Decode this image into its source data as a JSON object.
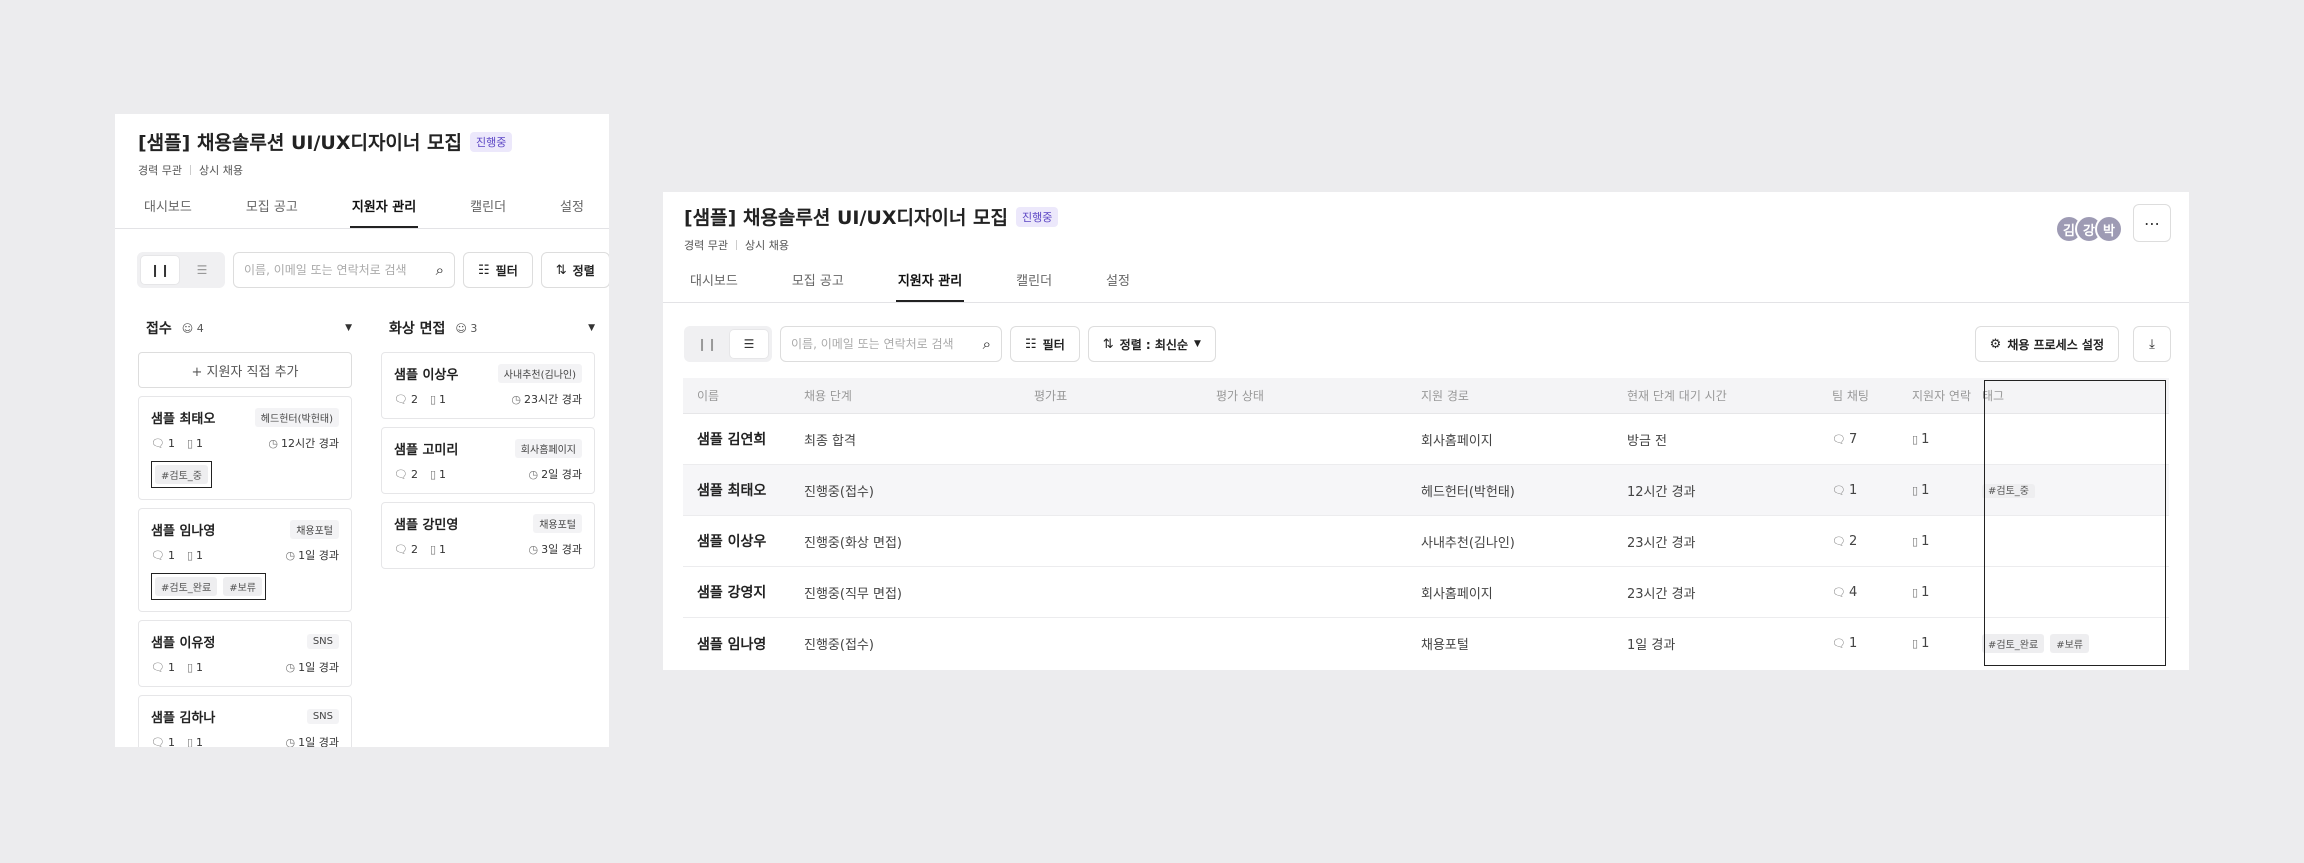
{
  "job": {
    "title": "[샘플] 채용솔루션 UI/UX디자이너 모집",
    "status_badge": "진행중",
    "experience": "경력 무관",
    "hire_type": "상시 채용"
  },
  "tabs": [
    "대시보드",
    "모집 공고",
    "지원자 관리",
    "캘린더",
    "설정"
  ],
  "toolbar": {
    "search_placeholder": "이름, 이메일 또는 연락처로 검색",
    "filter_label": "필터",
    "sort_label_short": "정렬",
    "sort_label": "정렬 : 최신순",
    "process_settings_label": "채용 프로세스 설정"
  },
  "kanban": {
    "add_applicant_label": "+ 지원자 직접 추가",
    "columns": [
      {
        "name": "접수",
        "count": "4",
        "cards": [
          {
            "name": "샘플 최태오",
            "source": "헤드헌터(박헌태)",
            "comments": "1",
            "memos": "1",
            "elapsed": "12시간 경과",
            "tags": [
              "#검토_중"
            ]
          },
          {
            "name": "샘플 임나영",
            "source": "채용포털",
            "comments": "1",
            "memos": "1",
            "elapsed": "1일 경과",
            "tags": [
              "#검토_완료",
              "#보류"
            ]
          },
          {
            "name": "샘플 이유정",
            "source": "SNS",
            "comments": "1",
            "memos": "1",
            "elapsed": "1일 경과",
            "tags": []
          },
          {
            "name": "샘플 김하나",
            "source": "SNS",
            "comments": "1",
            "memos": "1",
            "elapsed": "1일 경과",
            "tags": []
          }
        ]
      },
      {
        "name": "화상 면접",
        "count": "3",
        "cards": [
          {
            "name": "샘플 이상우",
            "source": "사내추천(김나인)",
            "comments": "2",
            "memos": "1",
            "elapsed": "23시간 경과",
            "tags": []
          },
          {
            "name": "샘플 고미리",
            "source": "회사홈페이지",
            "comments": "2",
            "memos": "1",
            "elapsed": "2일 경과",
            "tags": []
          },
          {
            "name": "샘플 강민영",
            "source": "채용포털",
            "comments": "2",
            "memos": "1",
            "elapsed": "3일 경과",
            "tags": []
          }
        ]
      }
    ]
  },
  "team_avatars": [
    "김",
    "강",
    "박"
  ],
  "table": {
    "headers": [
      "이름",
      "채용 단계",
      "평가표",
      "평가 상태",
      "지원 경로",
      "현재 단계 대기 시간",
      "팀 채팅",
      "지원자 연락",
      "태그"
    ],
    "rows": [
      {
        "name": "샘플 김연희",
        "stage": "최종 합격",
        "scorecard": "",
        "eval_status": "",
        "source": "회사홈페이지",
        "wait": "방금 전",
        "team_chat": "7",
        "contact": "1",
        "tags": []
      },
      {
        "name": "샘플 최태오",
        "stage": "진행중(접수)",
        "scorecard": "",
        "eval_status": "",
        "source": "헤드헌터(박헌태)",
        "wait": "12시간 경과",
        "team_chat": "1",
        "contact": "1",
        "tags": [
          "#검토_중"
        ]
      },
      {
        "name": "샘플 이상우",
        "stage": "진행중(화상 면접)",
        "scorecard": "",
        "eval_status": "",
        "source": "사내추천(김나인)",
        "wait": "23시간 경과",
        "team_chat": "2",
        "contact": "1",
        "tags": []
      },
      {
        "name": "샘플 강영지",
        "stage": "진행중(직무 면접)",
        "scorecard": "",
        "eval_status": "",
        "source": "회사홈페이지",
        "wait": "23시간 경과",
        "team_chat": "4",
        "contact": "1",
        "tags": []
      },
      {
        "name": "샘플 임나영",
        "stage": "진행중(접수)",
        "scorecard": "",
        "eval_status": "",
        "source": "채용포털",
        "wait": "1일 경과",
        "team_chat": "1",
        "contact": "1",
        "tags": [
          "#검토_완료",
          "#보류"
        ]
      }
    ]
  }
}
